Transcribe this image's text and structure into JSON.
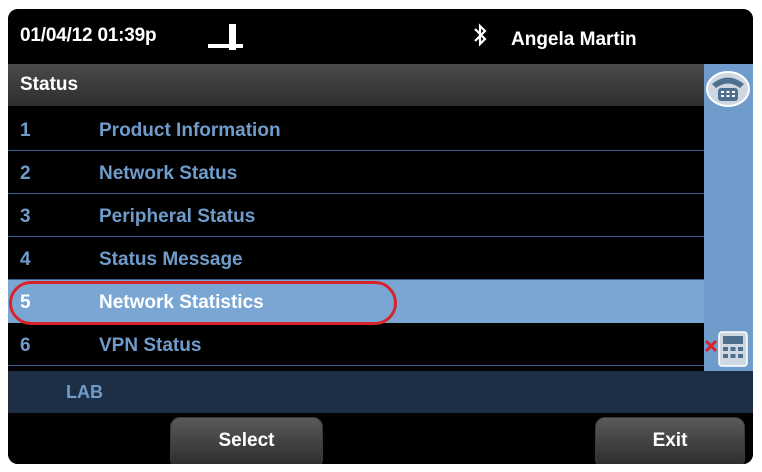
{
  "header": {
    "datetime": "01/04/12 01:39p",
    "user_name": "Angela Martin",
    "icons": [
      "handset-offhook-icon",
      "bluetooth-icon"
    ]
  },
  "title": "Status",
  "menu": {
    "items": [
      {
        "num": "1",
        "label": "Product Information",
        "selected": false
      },
      {
        "num": "2",
        "label": "Network Status",
        "selected": false
      },
      {
        "num": "3",
        "label": "Peripheral Status",
        "selected": false
      },
      {
        "num": "4",
        "label": "Status Message",
        "selected": false
      },
      {
        "num": "5",
        "label": "Network Statistics",
        "selected": true
      },
      {
        "num": "6",
        "label": "VPN Status",
        "selected": false
      }
    ]
  },
  "side": {
    "icons": [
      "phone-line-icon",
      "missed-call-line-icon"
    ]
  },
  "label_bar": "LAB",
  "softkeys": {
    "select": "Select",
    "exit": "Exit"
  },
  "colors": {
    "accent": "#6f9ccb",
    "selected_bg": "#7aa6d4",
    "highlight_ring": "#d8232a",
    "background": "#000000"
  }
}
